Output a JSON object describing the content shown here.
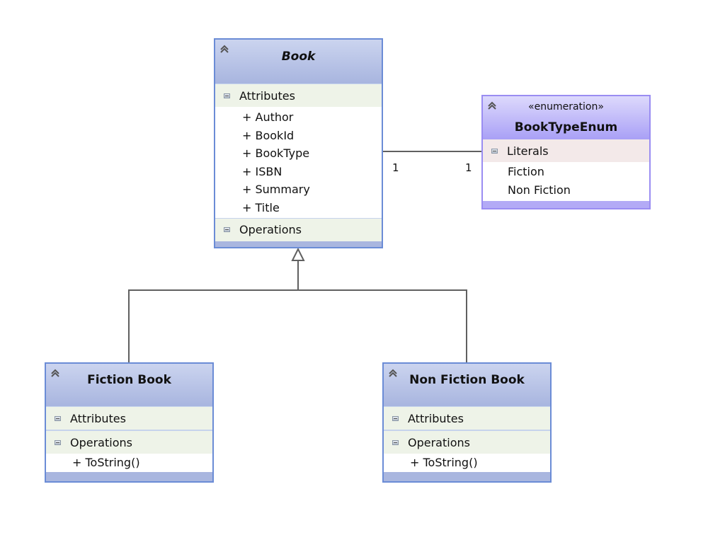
{
  "diagram": {
    "classes": {
      "book": {
        "name": "Book",
        "abstract": true,
        "compartments": [
          {
            "label": "Attributes",
            "items": [
              "+ Author",
              "+ BookId",
              "+ BookType",
              "+ ISBN",
              "+ Summary",
              "+ Title"
            ]
          },
          {
            "label": "Operations",
            "items": []
          }
        ]
      },
      "book_type_enum": {
        "stereotype": "«enumeration»",
        "name": "BookTypeEnum",
        "compartments": [
          {
            "label": "Literals",
            "items": [
              "Fiction",
              "Non Fiction"
            ]
          }
        ]
      },
      "fiction_book": {
        "name": "Fiction Book",
        "compartments": [
          {
            "label": "Attributes",
            "items": []
          },
          {
            "label": "Operations",
            "items": [
              "+ ToString()"
            ]
          }
        ]
      },
      "non_fiction_book": {
        "name": "Non Fiction Book",
        "compartments": [
          {
            "label": "Attributes",
            "items": []
          },
          {
            "label": "Operations",
            "items": [
              "+ ToString()"
            ]
          }
        ]
      }
    },
    "relationships": [
      {
        "type": "association",
        "from": "Book",
        "to": "BookTypeEnum",
        "source_multiplicity": "1",
        "target_multiplicity": "1"
      },
      {
        "type": "generalization",
        "from": "Fiction Book",
        "to": "Book"
      },
      {
        "type": "generalization",
        "from": "Non Fiction Book",
        "to": "Book"
      }
    ],
    "colors": {
      "class_border": "#6b8cd6",
      "class_header": "#a8b5df",
      "enum_border": "#9a8df2",
      "enum_header": "#a9a0f6",
      "compartment_bg": "#eef3e8",
      "literal_compartment_bg": "#f3e9e9",
      "connector": "#606060"
    }
  }
}
